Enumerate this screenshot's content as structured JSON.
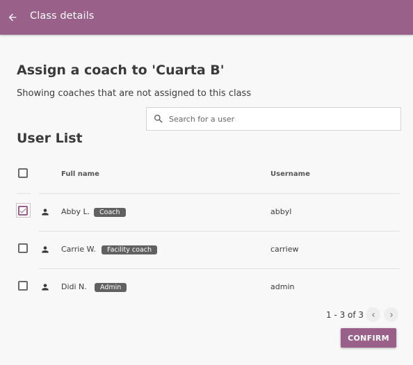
{
  "appbar": {
    "title": "Class details",
    "back_icon": "arrow-left-icon",
    "color": "#996189"
  },
  "page": {
    "heading": "Assign a coach to 'Cuarta B'",
    "subtext": "Showing coaches that are not assigned to this class"
  },
  "search": {
    "placeholder": "Search for a user",
    "value": "",
    "icon": "search-icon"
  },
  "user_list": {
    "heading": "User List",
    "columns": [
      "Full name",
      "Username"
    ],
    "rows": [
      {
        "name": "Abby L.",
        "role": "Coach",
        "username": "abbyl",
        "selected": true
      },
      {
        "name": "Carrie W.",
        "role": "Facility coach",
        "username": "carriew",
        "selected": false
      },
      {
        "name": "Didi N.",
        "role": "Admin",
        "username": "admin",
        "selected": false
      }
    ]
  },
  "pagination": {
    "text": "1 - 3 of 3"
  },
  "confirm_button": {
    "label": "CONFIRM"
  },
  "colors": {
    "accent": "#996189",
    "badge": "#616161"
  }
}
